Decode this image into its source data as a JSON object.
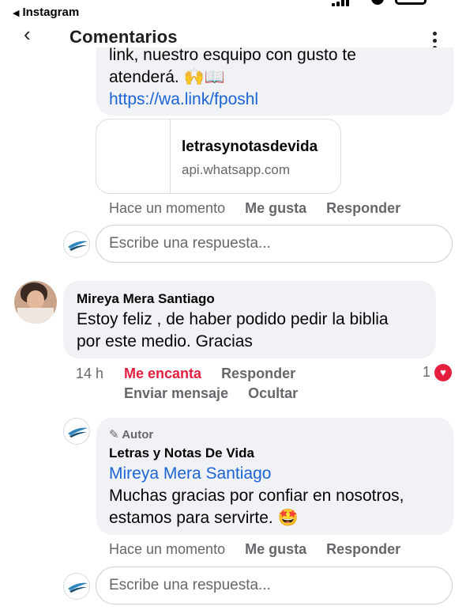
{
  "status_bar": {
    "back_app": "Instagram"
  },
  "header": {
    "title": "Comentarios"
  },
  "first_comment": {
    "text_line1": "link, nuestro esquipo con gusto te",
    "text_line2": "atenderá. 🙌📖",
    "link": "https://wa.link/fposhl",
    "card_title": "letrasynotasdevida",
    "card_domain": "api.whatsapp.com",
    "time": "Hace un momento",
    "like": "Me gusta",
    "reply": "Responder"
  },
  "reply_box_1": {
    "placeholder": "Escribe una respuesta..."
  },
  "second_comment": {
    "author": "Mireya Mera Santiago",
    "text_line1": "Estoy feliz , de haber podido pedir la biblia",
    "text_line2": "por este medio. Gracias",
    "time": "14 h",
    "reaction_label": "Me encanta",
    "reply": "Responder",
    "reaction_count": "1",
    "send_message": "Enviar mensaje",
    "hide": "Ocultar"
  },
  "author_reply": {
    "author_badge": "Autor",
    "author": "Letras y Notas De Vida",
    "mention": "Mireya Mera Santiago",
    "text_line1": "Muchas gracias por confiar en nosotros,",
    "text_line2": "estamos para servirte. 🤩",
    "time": "Hace un momento",
    "like": "Me gusta",
    "reply": "Responder"
  },
  "reply_box_2": {
    "placeholder": "Escribe una respuesta..."
  },
  "colors": {
    "link": "#1b63d6",
    "reaction": "#e41e3f",
    "bubble": "#f0f2f5"
  }
}
